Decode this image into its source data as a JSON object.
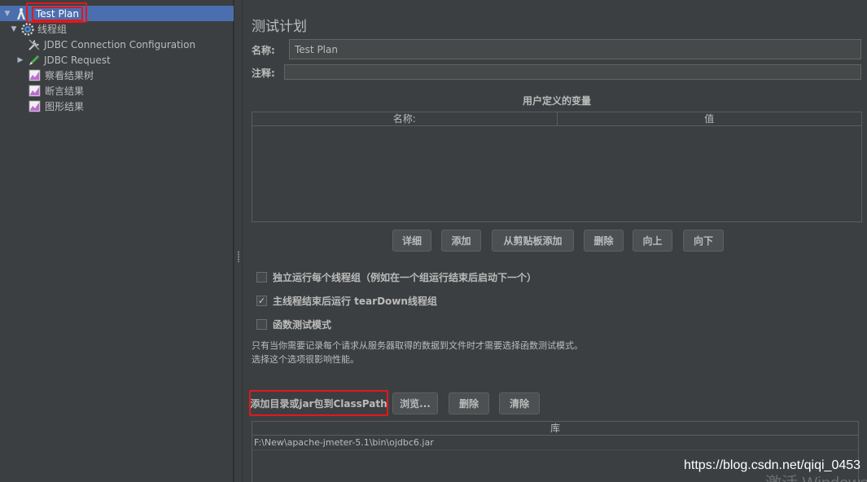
{
  "tree": {
    "items": [
      {
        "label": "Test Plan",
        "icon": "test-plan-icon"
      },
      {
        "label": "线程组",
        "icon": "gear-icon"
      },
      {
        "label": "JDBC Connection Configuration",
        "icon": "wrench-icon"
      },
      {
        "label": "JDBC Request",
        "icon": "sampler-pen-icon"
      },
      {
        "label": "察看结果树",
        "icon": "chart-icon"
      },
      {
        "label": "断言结果",
        "icon": "chart-icon"
      },
      {
        "label": "图形结果",
        "icon": "chart-icon"
      }
    ]
  },
  "main": {
    "title": "测试计划",
    "name_label": "名称:",
    "name_value": "Test Plan",
    "comment_label": "注释:",
    "comment_value": "",
    "variables": {
      "title": "用户定义的变量",
      "col_name": "名称:",
      "col_value": "值",
      "buttons": {
        "detail": "详细",
        "add": "添加",
        "add_from_clipboard": "从剪贴板添加",
        "delete": "删除",
        "up": "向上",
        "down": "向下"
      }
    },
    "options": {
      "run_serially": {
        "label": "独立运行每个线程组（例如在一个组运行结束后启动下一个）",
        "checked": false
      },
      "teardown": {
        "label": "主线程结束后运行 tearDown线程组",
        "checked": true
      },
      "functional_mode": {
        "label": "函数测试模式",
        "checked": false
      }
    },
    "note_line1": "只有当你需要记录每个请求从服务器取得的数据到文件时才需要选择函数测试模式。",
    "note_line2": "选择这个选项很影响性能。",
    "classpath": {
      "label": "添加目录或jar包到ClassPath",
      "browse": "浏览...",
      "delete": "删除",
      "clear": "清除",
      "column": "库",
      "entries": [
        "F:\\New\\apache-jmeter-5.1\\bin\\ojdbc6.jar"
      ]
    }
  },
  "watermark": "https://blog.csdn.net/qiqi_0453",
  "watermark_faint": "激活 Windows",
  "colors": {
    "selection": "#4b6eaf",
    "highlight_border": "#e0191b",
    "background": "#3c3f41"
  }
}
